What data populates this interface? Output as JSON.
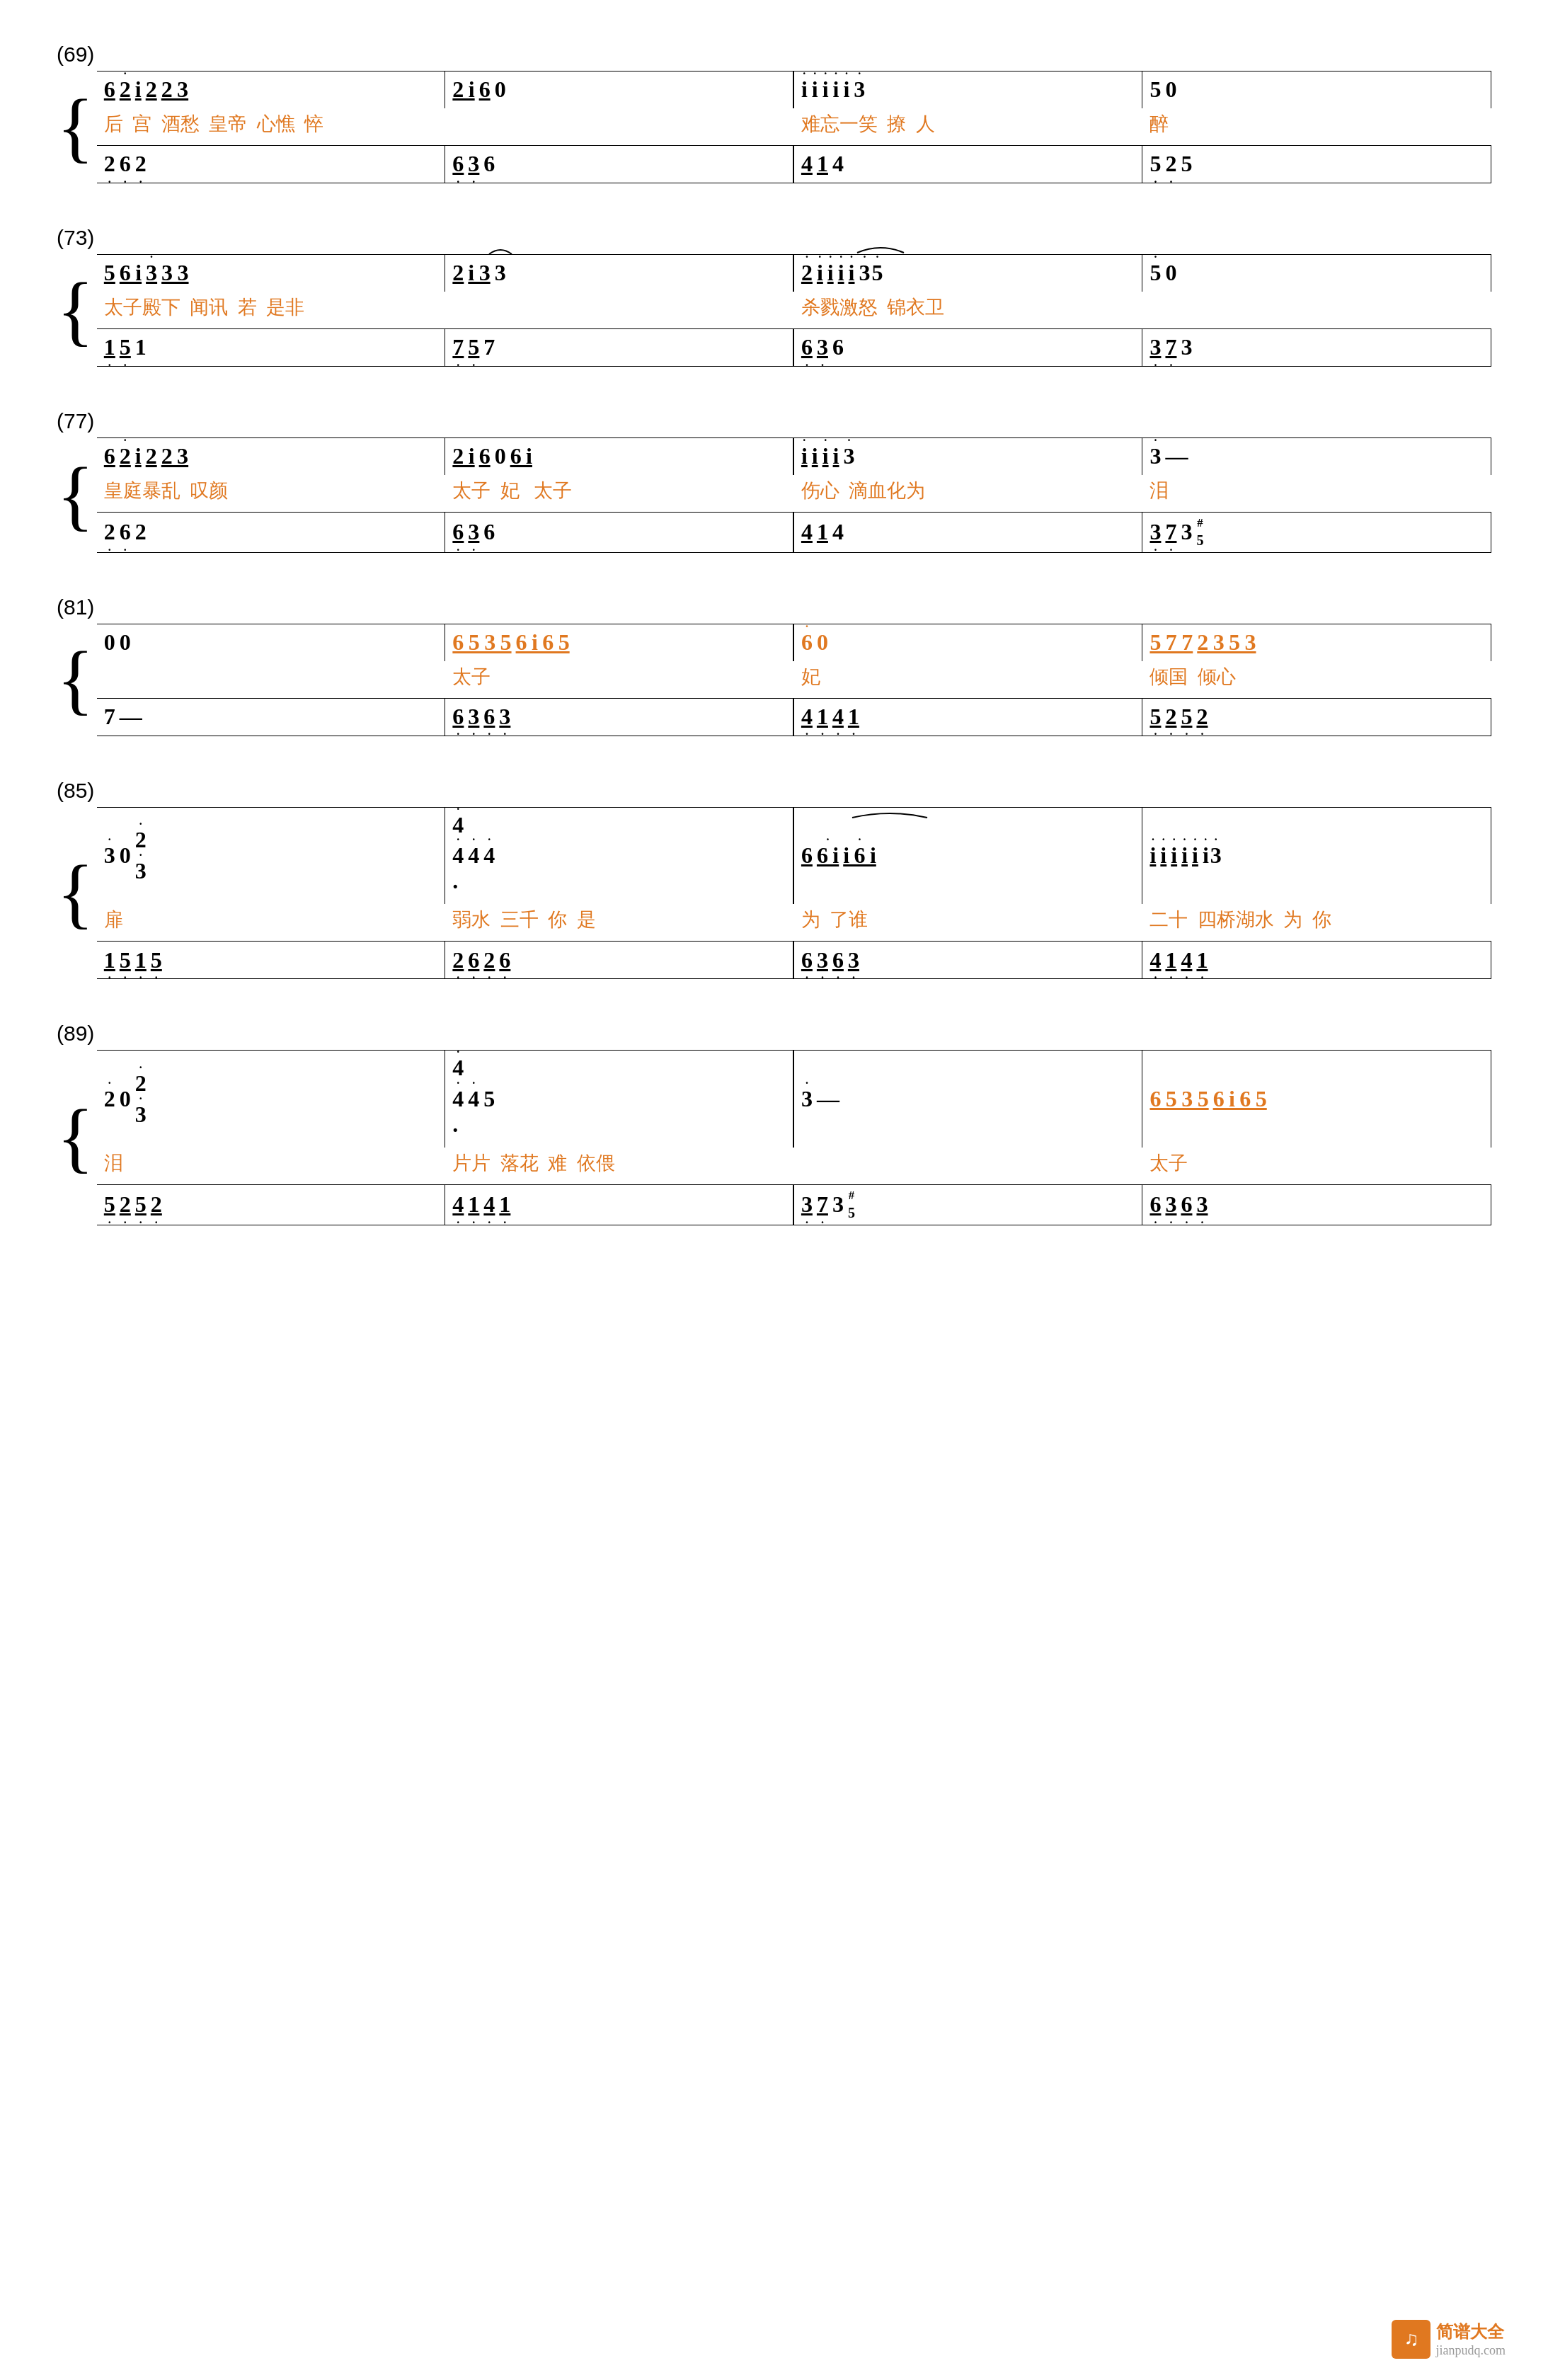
{
  "systems": [
    {
      "number": "(69)",
      "top_row": [
        {
          "measures": [
            {
              "notes": [
                "6̲",
                "2̲̇",
                "i̲",
                "2̲",
                "2̲3̲"
              ],
              "type": "note"
            },
            {
              "notes": [
                "2̲i̲",
                "6̲",
                "0"
              ],
              "type": "note"
            },
            {
              "notes": [
                "i̇",
                "i̇",
                "i̇",
                "i̇",
                "i̇",
                "3̇"
              ],
              "type": "note",
              "slur": true
            },
            {
              "notes": [
                "5",
                "0"
              ],
              "type": "note"
            }
          ]
        },
        {
          "lyrics": [
            "后宫",
            "酒愁",
            "皇帝",
            "心憔悴",
            "",
            "难忘一笑",
            "撩",
            "人",
            "醉"
          ]
        }
      ],
      "bot_row": [
        {
          "measures": [
            {
              "notes": [
                "2̤",
                "6̤",
                "2̤"
              ],
              "type": "note"
            },
            {
              "notes": [
                "6̤3̤",
                "6"
              ],
              "type": "note"
            },
            {
              "notes": [
                "4̲",
                "1̲",
                "4"
              ],
              "type": "note"
            },
            {
              "notes": [
                "5̤2̤",
                "5"
              ],
              "type": "note"
            }
          ]
        }
      ]
    },
    {
      "number": "(73)",
      "top_row": [
        {
          "measures": [
            {
              "notes": [
                "5̲",
                "6̲i̲",
                "3̲̇",
                "3̲3̲"
              ],
              "type": "note"
            },
            {
              "notes": [
                "2̲",
                "i̲3̲",
                "3̊"
              ],
              "type": "note",
              "slur_end": true
            },
            {
              "notes": [
                "2̲̇",
                "i̲̇",
                "i̲̇",
                "i̲̇",
                "i̲̇",
                "3̇5̲"
              ],
              "type": "note",
              "slur": true
            },
            {
              "notes": [
                "5̇",
                "0"
              ],
              "type": "note"
            }
          ]
        },
        {
          "lyrics": [
            "太子殿下",
            "闻讯",
            "若是非",
            "",
            "杀戮激怒",
            "锦衣卫"
          ]
        }
      ],
      "bot_row": [
        {
          "measures": [
            {
              "notes": [
                "1̤",
                "5̤",
                "1"
              ],
              "type": "note"
            },
            {
              "notes": [
                "7̤5̤",
                "7"
              ],
              "type": "note"
            },
            {
              "notes": [
                "6̤3̤",
                "6"
              ],
              "type": "note"
            },
            {
              "notes": [
                "3̤7̤",
                "3"
              ],
              "type": "note"
            }
          ]
        }
      ]
    },
    {
      "number": "(77)",
      "top_row": [
        {
          "measures": [
            {
              "notes": [
                "6̲",
                "2̲̇",
                "i̲",
                "2̲",
                "2̲3̲"
              ],
              "type": "note"
            },
            {
              "notes": [
                "2̲i̲",
                "6̲",
                "0",
                "6̲i̲"
              ],
              "type": "note"
            },
            {
              "notes": [
                "i̲̇",
                "i̲",
                "i̲̇",
                "i̲",
                "3̇"
              ],
              "type": "note"
            },
            {
              "notes": [
                "3̇",
                "—"
              ],
              "type": "note"
            }
          ]
        },
        {
          "lyrics": [
            "皇庭暴乱",
            "叹颜",
            "太子妃",
            "太子",
            "伤心",
            "滴血化为",
            "泪"
          ]
        }
      ],
      "bot_row": [
        {
          "measures": [
            {
              "notes": [
                "2̤",
                "6̤",
                "2"
              ],
              "type": "note"
            },
            {
              "notes": [
                "6̤3̤",
                "6"
              ],
              "type": "note"
            },
            {
              "notes": [
                "4̲",
                "1̲",
                "4"
              ],
              "type": "note"
            },
            {
              "notes": [
                "3̤7̤",
                "3",
                "#5"
              ],
              "type": "note"
            }
          ]
        }
      ]
    },
    {
      "number": "(81)",
      "top_row": [
        {
          "measures": [
            {
              "notes": [
                "0",
                "0"
              ],
              "type": "note"
            },
            {
              "notes": [
                "6̲5̲3̲5̲",
                "6̲i̲6̲5̲"
              ],
              "type": "note"
            },
            {
              "notes": [
                "6̇",
                "0"
              ],
              "type": "note"
            },
            {
              "notes": [
                "5̲7̲7̲",
                "2̲3̲5̲3̲"
              ],
              "type": "note"
            }
          ]
        },
        {
          "lyrics": [
            "",
            "",
            "太子",
            "",
            "妃",
            "",
            "倾国",
            "倾心"
          ]
        }
      ],
      "bot_row": [
        {
          "measures": [
            {
              "notes": [
                "7"
              ],
              "type": "note"
            },
            {
              "notes": [
                "—"
              ],
              "type": "note"
            },
            {
              "notes": [
                "6̤3̤",
                "6̤3̤"
              ],
              "type": "note"
            },
            {
              "notes": [
                "4̤1̤",
                "4̤1̤"
              ],
              "type": "note"
            },
            {
              "notes": [
                "5̤2̤",
                "5̤2̤"
              ],
              "type": "note"
            }
          ]
        }
      ]
    },
    {
      "number": "(85)",
      "top_row": [
        {
          "measures": [
            {
              "notes": [
                "3̇",
                "0",
                "2̇3̇"
              ],
              "type": "note"
            },
            {
              "notes": [
                "4̇4̇·",
                "4̇",
                "4̇"
              ],
              "type": "note"
            },
            {
              "notes": [
                "6̲",
                "6̲i̲",
                "i̲6̲i̲"
              ],
              "type": "note",
              "slur": true
            },
            {
              "notes": [
                "i̲̇",
                "i̲̇",
                "i̲̇",
                "i̲̇",
                "i̲̇",
                "i̇3̇"
              ],
              "type": "note"
            }
          ]
        },
        {
          "lyrics": [
            "扉",
            "",
            "弱水三千",
            "你是为了谁",
            "",
            "二十四桥湖水为你"
          ]
        }
      ],
      "bot_row": [
        {
          "measures": [
            {
              "notes": [
                "1̤5̤",
                "1̤5̤"
              ],
              "type": "note"
            },
            {
              "notes": [
                "2̤6̤",
                "2̤6̤"
              ],
              "type": "note"
            },
            {
              "notes": [
                "6̤3̤",
                "6̤3̤"
              ],
              "type": "note"
            },
            {
              "notes": [
                "4̤1̤",
                "4̤1̤"
              ],
              "type": "note"
            }
          ]
        }
      ]
    },
    {
      "number": "(89)",
      "top_row": [
        {
          "measures": [
            {
              "notes": [
                "2̇",
                "0",
                "2̇3̇"
              ],
              "type": "note"
            },
            {
              "notes": [
                "4̇4̇·",
                "4̇",
                "5"
              ],
              "type": "note"
            },
            {
              "notes": [
                "3̇",
                "—"
              ],
              "type": "note"
            },
            {
              "notes": [
                "6̲5̲3̲5̲",
                "6̲i̲6̲5̲"
              ],
              "type": "note"
            }
          ]
        },
        {
          "lyrics": [
            "泪",
            "",
            "片片落花",
            "难依偎",
            "",
            "太子"
          ]
        }
      ],
      "bot_row": [
        {
          "measures": [
            {
              "notes": [
                "5̤2̤",
                "5̤2̤"
              ],
              "type": "note"
            },
            {
              "notes": [
                "4̤1̤",
                "4̤1̤"
              ],
              "type": "note"
            },
            {
              "notes": [
                "3̤7̤",
                "3",
                "#5"
              ],
              "type": "note"
            },
            {
              "notes": [
                "6̤3̤",
                "6̤3̤"
              ],
              "type": "note"
            }
          ]
        }
      ]
    }
  ],
  "watermark": {
    "site": "jianpudq.com",
    "logo_text": "简谱大全"
  }
}
